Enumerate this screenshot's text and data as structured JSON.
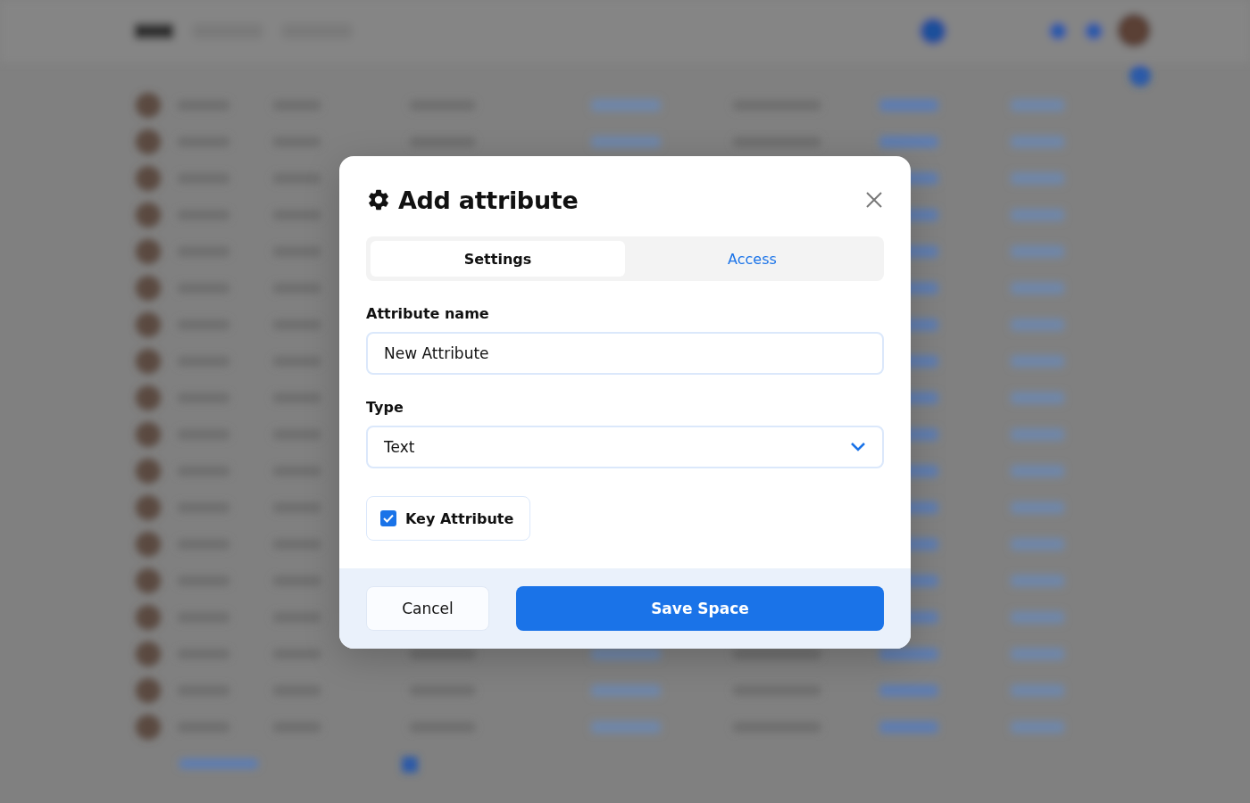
{
  "dialog": {
    "title": "Add attribute",
    "tabs": [
      {
        "label": "Settings",
        "selected": true
      },
      {
        "label": "Access",
        "selected": false
      }
    ],
    "fields": [
      {
        "kind": "text",
        "label": "Attribute name",
        "value": "New Attribute"
      },
      {
        "kind": "select",
        "label": "Type",
        "value": "Text"
      }
    ],
    "key_attribute": {
      "label": "Key Attribute",
      "checked": true
    },
    "buttons": [
      {
        "kind": "secondary",
        "label": "Cancel"
      },
      {
        "kind": "primary",
        "label": "Save Space"
      }
    ]
  }
}
